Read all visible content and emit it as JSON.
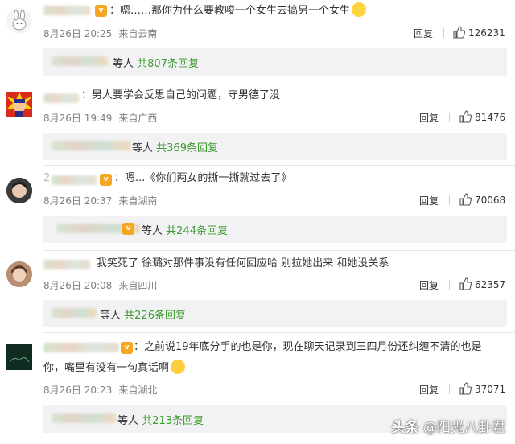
{
  "comments": [
    {
      "text": "嗯……那你为什么要教唆一个女生去搞另一个女生",
      "date": "8月26日 20:25",
      "location": "来自云南",
      "reply_label": "回复",
      "likes": "126231",
      "sub_count_prefix": "等人",
      "sub_count": "共807条回复"
    },
    {
      "text": "男人要学会反思自己的问题，守男德了没",
      "date": "8月26日 19:49",
      "location": "来自广西",
      "reply_label": "回复",
      "likes": "81476",
      "sub_count_prefix": "等人",
      "sub_count": "共369条回复"
    },
    {
      "name_prefix": "2",
      "text": "嗯...《你们两女的撕一撕就过去了》",
      "date": "8月26日 20:37",
      "location": "来自湖南",
      "reply_label": "回复",
      "likes": "70068",
      "sub_count_prefix": "等人",
      "sub_count": "共244条回复"
    },
    {
      "text": "我笑死了 徐璐对那件事没有任何回应哈 别拉她出来 和她没关系",
      "date": "8月26日 20:08",
      "location": "来自四川",
      "reply_label": "回复",
      "likes": "62357",
      "sub_count_prefix": "等人",
      "sub_count": "共226条回复"
    },
    {
      "text_line1": "之前说19年底分手的也是你，现在聊天记录到三四月份还纠缠不清的也是",
      "text_line2": "你，嘴里有没有一句真话啊",
      "date": "8月26日 20:23",
      "location": "来自湖北",
      "reply_label": "回复",
      "likes": "37071",
      "sub_count_prefix": "等人",
      "sub_count": "共213条回复"
    }
  ],
  "watermark": {
    "brand": "头条",
    "handle": "@阳光八卦君"
  },
  "colors": {
    "accent_green": "#3d9c2f",
    "meta_gray": "#808080",
    "sub_bg": "#f2f2f5"
  }
}
